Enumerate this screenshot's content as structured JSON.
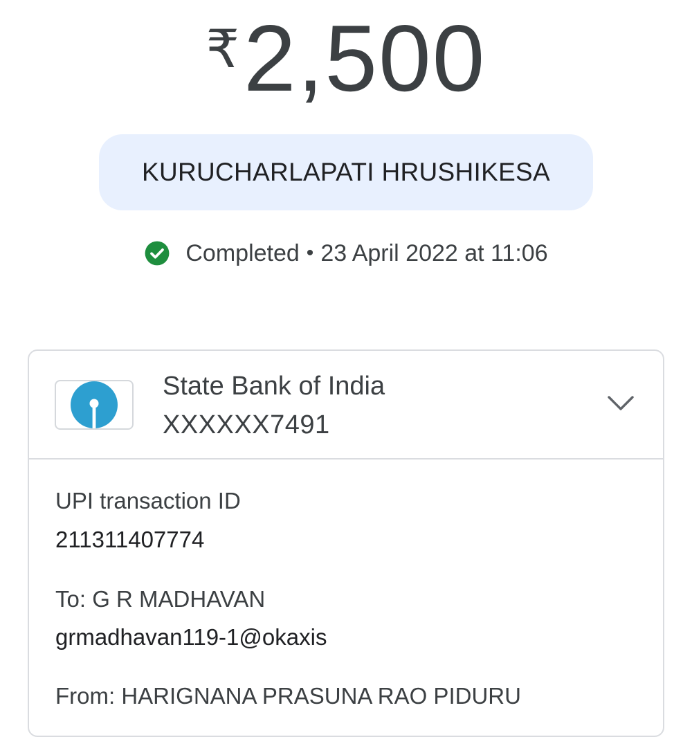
{
  "amount": {
    "currency_symbol": "₹",
    "value": "2,500"
  },
  "payee": {
    "name": "KURUCHARLAPATI HRUSHIKESA"
  },
  "status": {
    "icon": "check-circle-icon",
    "text": "Completed",
    "separator": "•",
    "datetime": "23 April 2022 at 11:06",
    "color": "#1e8e3e"
  },
  "account": {
    "bank_name": "State Bank of India",
    "account_number": "XXXXXX7491",
    "logo_icon": "sbi-logo-icon",
    "logo_color": "#2d9fd0",
    "expand_icon": "chevron-down-icon"
  },
  "details": {
    "upi_label": "UPI transaction ID",
    "upi_value": "211311407774",
    "to_label": "To: G R  MADHAVAN",
    "to_value": "grmadhavan119-1@okaxis",
    "from_label": "From: HARIGNANA PRASUNA RAO  PIDURU"
  },
  "colors": {
    "chip_background": "#e8f0fe",
    "text": "#3c4043",
    "border": "#dadce0"
  }
}
